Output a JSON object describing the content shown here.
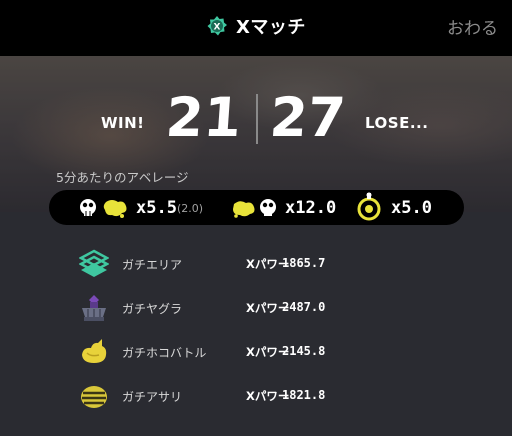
{
  "header": {
    "title": "Xマッチ",
    "close_label": "おわる",
    "badge_icon": "x-rank-badge-icon"
  },
  "score": {
    "win_label": "WIN!",
    "win_count": "21",
    "lose_count": "27",
    "lose_label": "LOSE..."
  },
  "average": {
    "label": "5分あたりのアベレージ",
    "kills_assists": "x5.5",
    "assists_note": "(2.0)",
    "deaths": "x12.0",
    "specials": "x5.0"
  },
  "modes": [
    {
      "name": "ガチエリア",
      "power_label": "Xパワー",
      "power_value": "1865.7",
      "icon": "splat-zones-icon"
    },
    {
      "name": "ガチヤグラ",
      "power_label": "Xパワー",
      "power_value": "2487.0",
      "icon": "tower-control-icon"
    },
    {
      "name": "ガチホコバトル",
      "power_label": "Xパワー",
      "power_value": "2145.8",
      "icon": "rainmaker-icon"
    },
    {
      "name": "ガチアサリ",
      "power_label": "Xパワー",
      "power_value": "1821.8",
      "icon": "clam-blitz-icon"
    }
  ],
  "colors": {
    "top_bar": "#000000",
    "background": "#2a2b31",
    "accent_green": "#3fc7a0",
    "accent_yellow": "#e8e33a"
  }
}
